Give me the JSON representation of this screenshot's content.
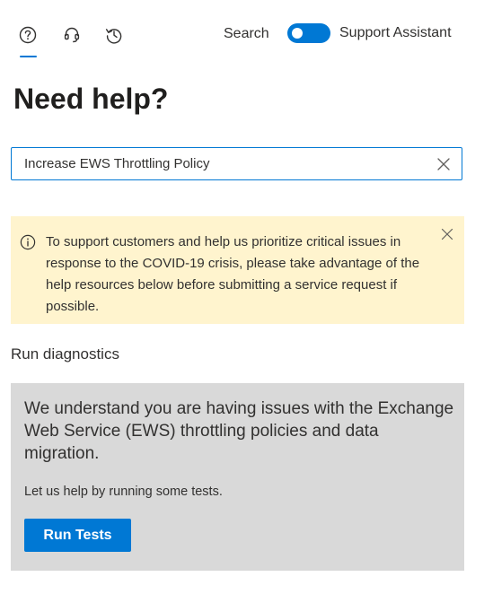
{
  "header": {
    "tabs": [
      {
        "icon": "help-icon",
        "selected": true
      },
      {
        "icon": "headset-icon",
        "selected": false
      },
      {
        "icon": "history-icon",
        "selected": false
      }
    ],
    "search_label": "Search",
    "toggle_on": true,
    "assistant_label": "Support Assistant"
  },
  "title": "Need help?",
  "search": {
    "value": "Increase EWS Throttling Policy",
    "clear_icon": "close-icon"
  },
  "notice": {
    "icon": "info-icon",
    "text": "To support customers and help us prioritize critical issues in response to the COVID-19 crisis, please take advantage of the help resources below before submitting a service request if possible.",
    "close_icon": "close-icon",
    "background": "#fff4ce"
  },
  "diagnostics": {
    "heading": "Run diagnostics",
    "message": "We understand you are having issues with the Exchange Web Service (EWS) throttling policies and data migration.",
    "sub_text": "Let us help by running some tests.",
    "button_label": "Run Tests"
  },
  "colors": {
    "accent": "#0078d4",
    "card_background": "#d9d9d9",
    "text": "#323130"
  }
}
